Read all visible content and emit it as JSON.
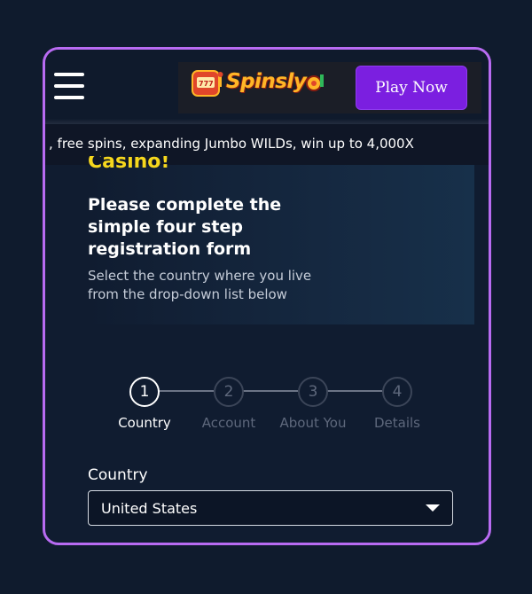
{
  "header": {
    "logo_text": "Spinsly",
    "play_button": "Play Now"
  },
  "ticker": {
    "text": ", free spins, expanding Jumbo WILDs, win up to 4,000X"
  },
  "hero": {
    "heading_partial": "Casino!",
    "subheading": "Please complete the simple four step registration form",
    "description": "Select the country where you live from the drop-down list below"
  },
  "steps": [
    {
      "number": "1",
      "label": "Country",
      "active": true
    },
    {
      "number": "2",
      "label": "Account",
      "active": false
    },
    {
      "number": "3",
      "label": "About You",
      "active": false
    },
    {
      "number": "4",
      "label": "Details",
      "active": false
    }
  ],
  "form": {
    "country_label": "Country",
    "country_value": "United States"
  },
  "colors": {
    "accent_purple": "#7b1fe0",
    "frame_border": "#b86bf2",
    "heading_yellow": "#f6d71d",
    "background": "#0f1b2d"
  },
  "icons": {
    "menu": "hamburger-menu-icon",
    "dropdown": "caret-down-icon"
  }
}
